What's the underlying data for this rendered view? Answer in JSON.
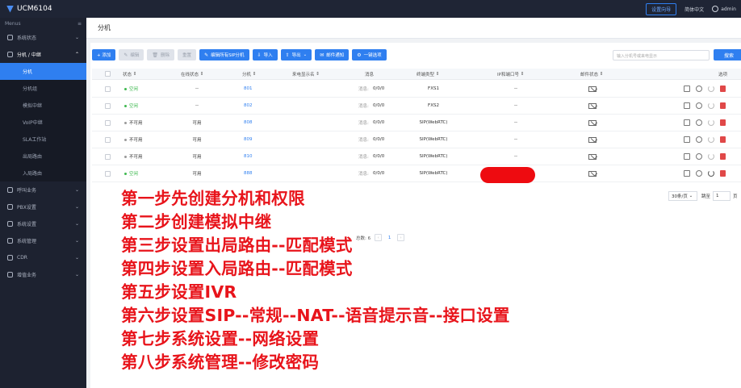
{
  "app": {
    "title": "UCM6104",
    "wizard": "设置向导",
    "language": "简体中文",
    "user": "admin"
  },
  "sidebar": {
    "menu_label": "Menus",
    "items": [
      {
        "label": "系统状态",
        "icon": "gauge-icon"
      },
      {
        "label": "分机 / 中继",
        "icon": "users-icon"
      },
      {
        "label": "呼叫业务",
        "icon": "phone-icon"
      },
      {
        "label": "PBX设置",
        "icon": "gear-icon"
      },
      {
        "label": "系统设置",
        "icon": "settings-icon"
      },
      {
        "label": "系统管理",
        "icon": "wrench-icon"
      },
      {
        "label": "CDR",
        "icon": "cdr-icon"
      },
      {
        "label": "增值业务",
        "icon": "plus-grid-icon"
      }
    ],
    "subitems": [
      "分机",
      "分机组",
      "模拟中继",
      "VoIP中继",
      "SLA工作站",
      "出局路由",
      "入局路由"
    ]
  },
  "page": {
    "title": "分机"
  },
  "toolbar": {
    "add": "+ 添加",
    "edit": "编辑",
    "delete": "删除",
    "reboot": "重置",
    "edit_sip": "编辑所有SIP分机",
    "import": "导入",
    "export": "导出",
    "email": "邮件通知",
    "onekey": "一键选项"
  },
  "search": {
    "placeholder": "输入分机号或来电显示",
    "button": "搜索"
  },
  "table": {
    "columns": [
      "状态",
      "在线状态",
      "分机",
      "来电显示名",
      "消息",
      "终端类型",
      "IP和端口号",
      "邮件状态",
      "选项"
    ],
    "rows": [
      {
        "status": "空闲",
        "status_color": "#3fb950",
        "online": "--",
        "ext": "801",
        "msg_label": "消息:",
        "msg": "0/0/0",
        "type": "FXS1",
        "ip": "--"
      },
      {
        "status": "空闲",
        "status_color": "#3fb950",
        "online": "--",
        "ext": "802",
        "msg_label": "消息:",
        "msg": "0/0/0",
        "type": "FXS2",
        "ip": "--"
      },
      {
        "status": "不可用",
        "status_color": "#999999",
        "online": "可用",
        "ext": "808",
        "msg_label": "消息:",
        "msg": "0/0/0",
        "type": "SIP(WebRTC)",
        "ip": "--"
      },
      {
        "status": "不可用",
        "status_color": "#999999",
        "online": "可用",
        "ext": "809",
        "msg_label": "消息:",
        "msg": "0/0/0",
        "type": "SIP(WebRTC)",
        "ip": "--"
      },
      {
        "status": "不可用",
        "status_color": "#999999",
        "online": "可用",
        "ext": "810",
        "msg_label": "消息:",
        "msg": "0/0/0",
        "type": "SIP(WebRTC)",
        "ip": "--"
      },
      {
        "status": "空闲",
        "status_color": "#3fb950",
        "online": "可用",
        "ext": "888",
        "msg_label": "消息:",
        "msg": "0/0/0",
        "type": "SIP(WebRTC)",
        "ip": ""
      }
    ]
  },
  "pager": {
    "total": "总数: 6",
    "page": "1",
    "per_page": "30条/页",
    "jump_label": "跳至",
    "jump_value": "1",
    "jump_unit": "页"
  },
  "steps": [
    "第一步先创建分机和权限",
    "第二步创建模拟中继",
    "第三步设置出局路由--匹配模式",
    "第四步设置入局路由--匹配模式",
    "第五步设置IVR",
    "第六步设置SIP--常规--NAT--语音提示音--接口设置",
    "第七步系统设置--网络设置",
    "第八步系统管理--修改密码"
  ]
}
